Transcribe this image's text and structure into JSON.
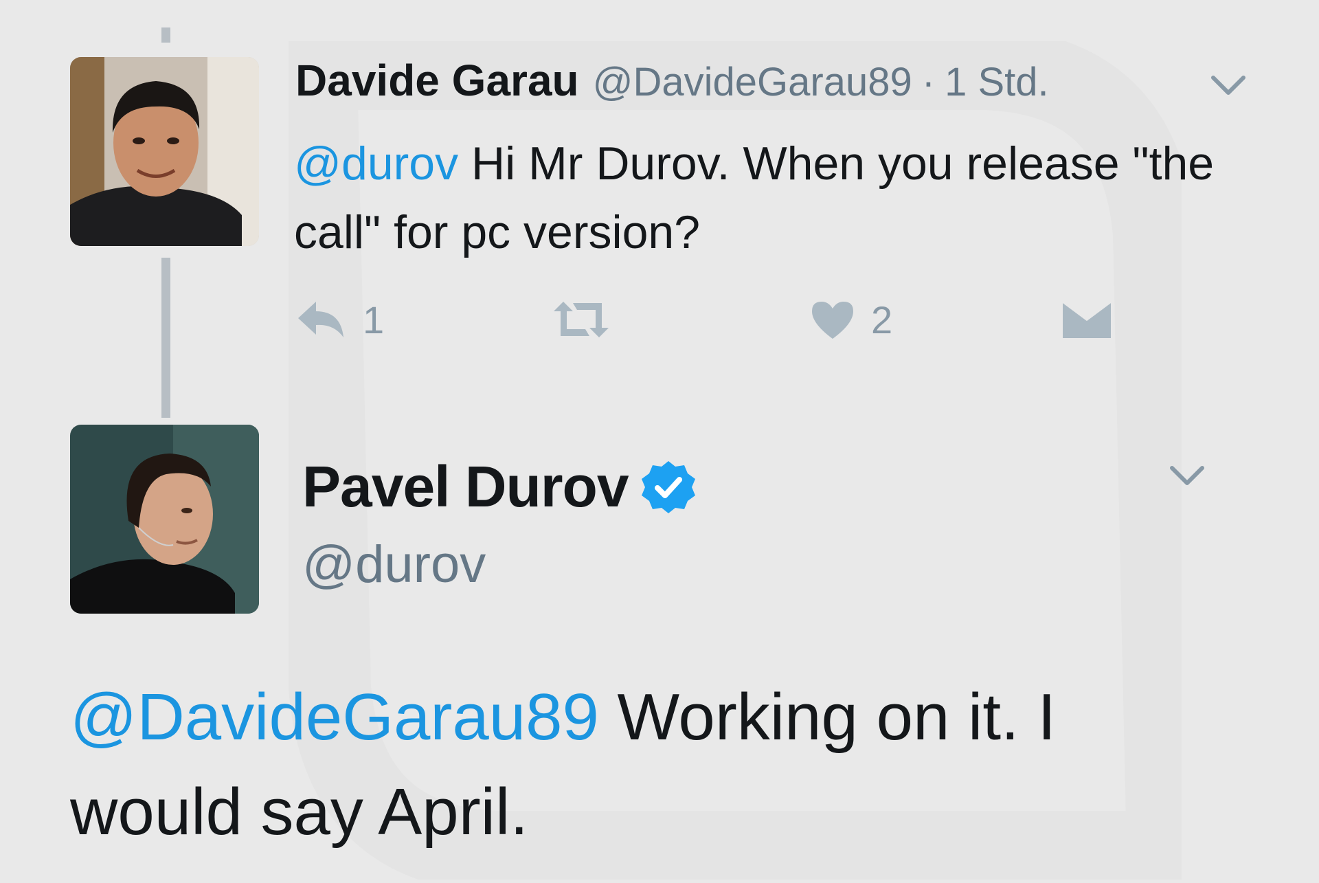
{
  "thread": {
    "reply_tweet": {
      "author_name": "Davide Garau",
      "author_handle": "@DavideGarau89",
      "separator": "·",
      "time": "1 Std.",
      "mention": "@durov",
      "text": " Hi Mr Durov. When you release \"the call\" for pc version?",
      "actions": {
        "reply_count": "1",
        "retweet_count": "",
        "like_count": "2"
      },
      "avatar_icon": "user-photo-davide",
      "menu_icon": "chevron-down-icon"
    },
    "main_tweet": {
      "author_name": "Pavel Durov",
      "author_handle": "@durov",
      "verified": true,
      "mention": "@DavideGarau89",
      "text": " Working on it. I would say April.",
      "avatar_icon": "user-photo-pavel",
      "menu_icon": "chevron-down-icon"
    }
  },
  "colors": {
    "background": "#e9e9e9",
    "link": "#1b95e0",
    "muted": "#657786",
    "verified": "#1da1f2",
    "thread_line": "#b7bec4"
  }
}
